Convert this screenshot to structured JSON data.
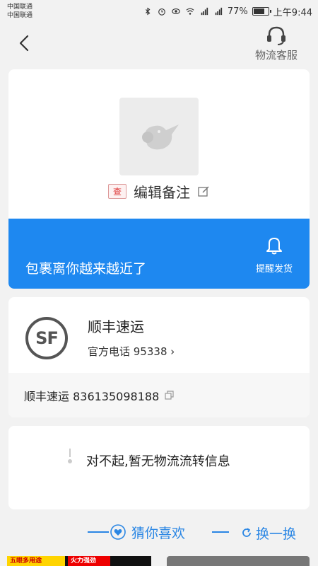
{
  "status_bar": {
    "carrier1": "中国联通",
    "carrier2": "中国联通",
    "battery": "77%",
    "battery_level": 0.77,
    "time": "上午9:44"
  },
  "header": {
    "service_label": "物流客服"
  },
  "package": {
    "badge": "查",
    "note_label": "编辑备注",
    "progress_message": "包裹离你越来越近了",
    "remind_label": "提醒发货"
  },
  "courier": {
    "logo_text": "SF",
    "name": "顺丰速运",
    "phone_label": "官方电话 95338",
    "tracking_label": "顺丰速运 836135098188"
  },
  "tracking": {
    "empty_message": "对不起,暂无物流流转信息"
  },
  "recommend": {
    "title": "猜你喜欢",
    "refresh_label": "换一换"
  },
  "products": {
    "tag1": "五眼多用途",
    "tag2": "火力强劲"
  },
  "colors": {
    "accent": "#1e88f0",
    "link": "#2a86e4"
  }
}
